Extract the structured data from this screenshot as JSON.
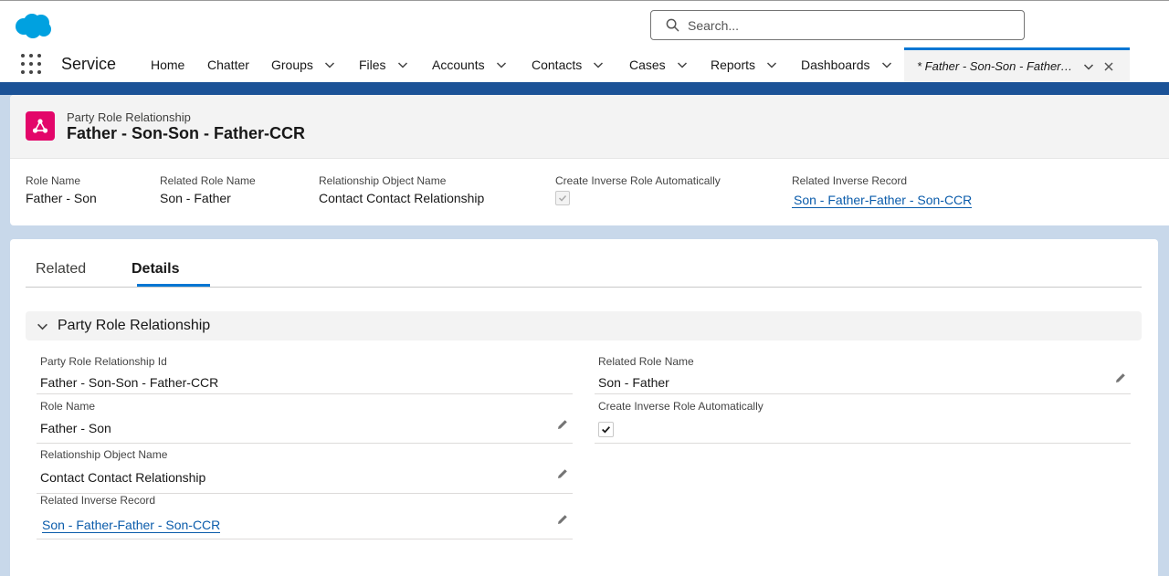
{
  "header": {
    "search_placeholder": "Search..."
  },
  "nav": {
    "app_name": "Service",
    "items": [
      {
        "label": "Home",
        "dropdown": false
      },
      {
        "label": "Chatter",
        "dropdown": false
      },
      {
        "label": "Groups",
        "dropdown": true
      },
      {
        "label": "Files",
        "dropdown": true
      },
      {
        "label": "Accounts",
        "dropdown": true
      },
      {
        "label": "Contacts",
        "dropdown": true
      },
      {
        "label": "Cases",
        "dropdown": true
      },
      {
        "label": "Reports",
        "dropdown": true
      },
      {
        "label": "Dashboards",
        "dropdown": true
      }
    ],
    "active_tab_label": "* Father - Son-Son - Father-CCR"
  },
  "record": {
    "object_label": "Party Role Relationship",
    "title": "Father - Son-Son - Father-CCR"
  },
  "highlights": {
    "role_name_label": "Role Name",
    "role_name_value": "Father - Son",
    "related_role_name_label": "Related Role Name",
    "related_role_name_value": "Son - Father",
    "relationship_object_label": "Relationship Object Name",
    "relationship_object_value": "Contact Contact Relationship",
    "create_inverse_label": "Create Inverse Role Automatically",
    "create_inverse_checked": true,
    "related_inverse_label": "Related Inverse Record",
    "related_inverse_value": "Son - Father-Father - Son-CCR"
  },
  "tabs": {
    "related": "Related",
    "details": "Details",
    "active": "details"
  },
  "details": {
    "section_title": "Party Role Relationship",
    "fields": {
      "id_label": "Party Role Relationship Id",
      "id_value": "Father - Son-Son - Father-CCR",
      "role_name_label": "Role Name",
      "role_name_value": "Father - Son",
      "relationship_object_label": "Relationship Object Name",
      "relationship_object_value": "Contact Contact Relationship",
      "related_inverse_label": "Related Inverse Record",
      "related_inverse_value": "Son - Father-Father - Son-CCR",
      "related_role_name_label": "Related Role Name",
      "related_role_name_value": "Son - Father",
      "create_inverse_label": "Create Inverse Role Automatically",
      "create_inverse_checked": true
    }
  },
  "colors": {
    "brand_blue": "#0176d3",
    "link_blue": "#0b5cab",
    "record_icon": "#e3066a",
    "salesforce_cloud": "#00a1e0"
  },
  "icons": {
    "logo": "salesforce-cloud-icon",
    "search": "search-icon",
    "app_launcher": "waffle-icon",
    "record": "relationship-icon",
    "edit": "pencil-icon",
    "collapse": "chevron-down-icon",
    "close": "close-icon"
  }
}
